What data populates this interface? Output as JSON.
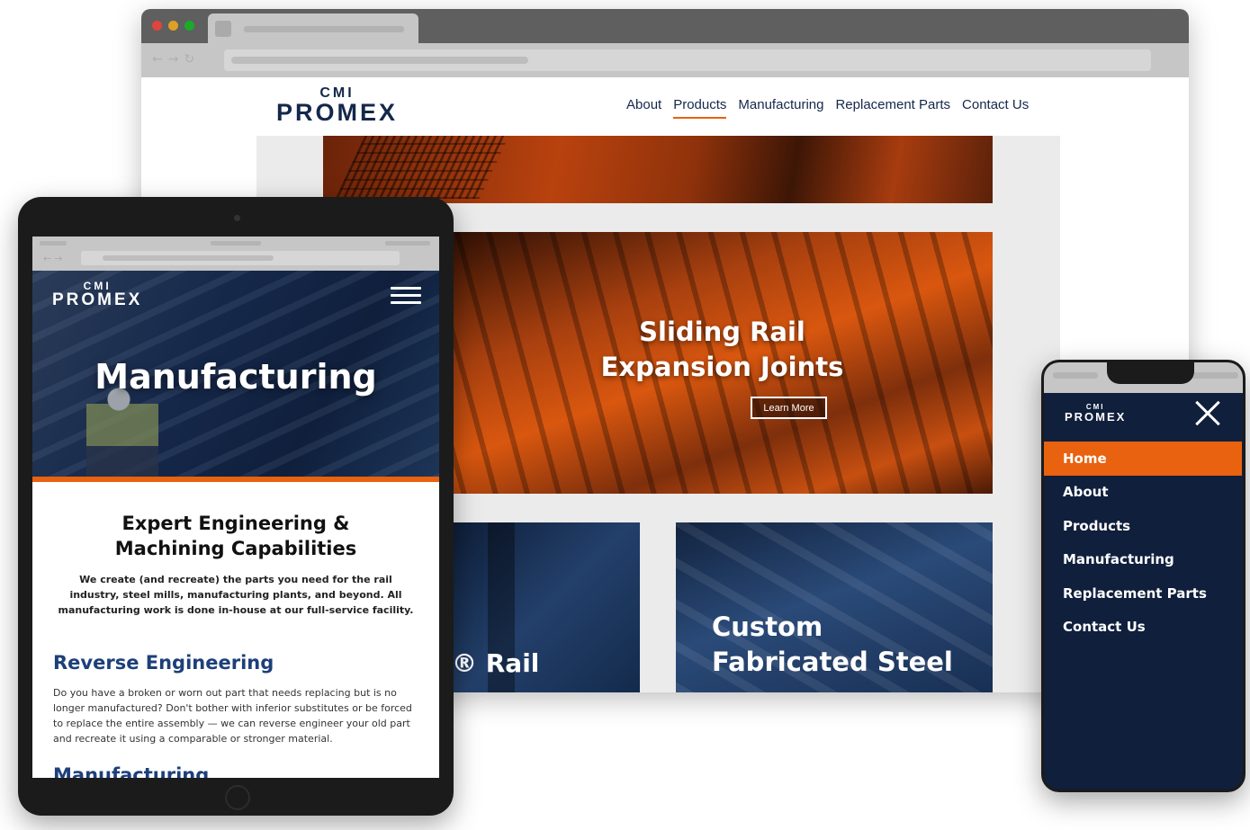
{
  "desktop": {
    "logo": {
      "top": "CMI",
      "bottom": "PROMEX"
    },
    "nav": [
      {
        "label": "About",
        "active": false
      },
      {
        "label": "Products",
        "active": true
      },
      {
        "label": "Manufacturing",
        "active": false
      },
      {
        "label": "Replacement Parts",
        "active": false
      },
      {
        "label": "Contact Us",
        "active": false
      }
    ],
    "hero_tile": {
      "title_line1": "Sliding Rail",
      "title_line2": "Expansion Joints",
      "button_label": "Learn More"
    },
    "tile_left": {
      "title_fragment": "® Rail"
    },
    "tile_right": {
      "title_line1": "Custom",
      "title_line2": "Fabricated Steel"
    }
  },
  "tablet": {
    "logo": {
      "top": "CMI",
      "bottom": "PROMEX"
    },
    "menu_icon": "hamburger-icon",
    "hero_title": "Manufacturing",
    "section_title_line1": "Expert Engineering &",
    "section_title_line2": "Machining Capabilities",
    "intro": "We create (and recreate) the parts you need for the rail industry, steel mills, manufacturing plants, and beyond. All manufacturing work is done in-house at our full-service facility.",
    "reverse_title": "Reverse Engineering",
    "reverse_body": "Do you have a broken or worn out part that needs replacing but is no longer manufactured? Don't bother with inferior substitutes or be forced to replace the entire assembly — we can reverse engineer your old part and recreate it using a comparable or stronger material.",
    "next_title": "Manufacturing"
  },
  "phone": {
    "logo": {
      "top": "CMI",
      "bottom": "PROMEX"
    },
    "close_icon": "close-icon",
    "menu": [
      {
        "label": "Home",
        "active": true
      },
      {
        "label": "About",
        "active": false
      },
      {
        "label": "Products",
        "active": false
      },
      {
        "label": "Manufacturing",
        "active": false
      },
      {
        "label": "Replacement Parts",
        "active": false
      },
      {
        "label": "Contact Us",
        "active": false
      }
    ]
  },
  "colors": {
    "navy": "#14284b",
    "orange": "#e8620f",
    "deep_navy": "#0f1f3c"
  }
}
